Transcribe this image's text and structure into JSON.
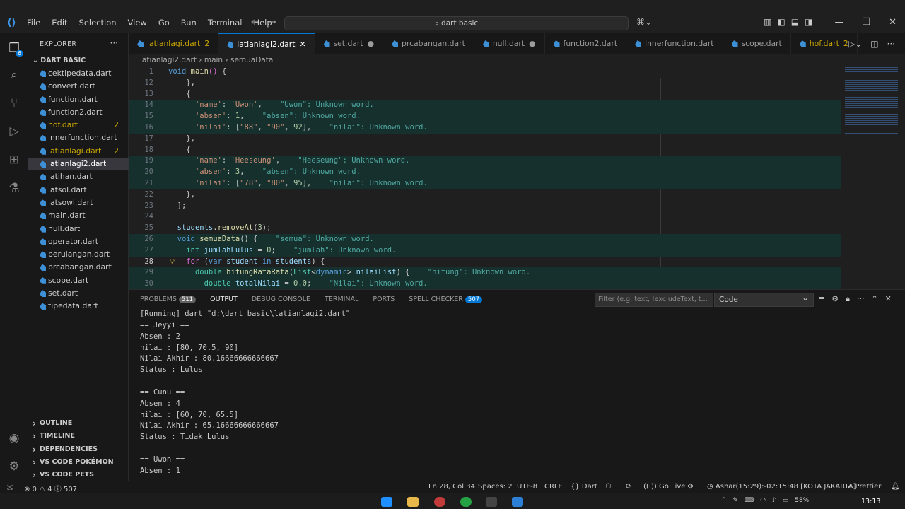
{
  "titlebar": {
    "menu": [
      "File",
      "Edit",
      "Selection",
      "View",
      "Go",
      "Run",
      "Terminal",
      "Help"
    ],
    "search": "dart basic"
  },
  "sidebar": {
    "header": "EXPLORER",
    "folder": "DART BASIC",
    "files": [
      {
        "name": "cektipedata.dart",
        "count": "",
        "state": "normal"
      },
      {
        "name": "convert.dart",
        "count": "",
        "state": "normal"
      },
      {
        "name": "function.dart",
        "count": "",
        "state": "normal"
      },
      {
        "name": "function2.dart",
        "count": "",
        "state": "normal"
      },
      {
        "name": "hof.dart",
        "count": "2",
        "state": "warn"
      },
      {
        "name": "innerfunction.dart",
        "count": "",
        "state": "normal"
      },
      {
        "name": "latianlagi.dart",
        "count": "2",
        "state": "warn"
      },
      {
        "name": "latianlagi2.dart",
        "count": "",
        "state": "selected"
      },
      {
        "name": "latihan.dart",
        "count": "",
        "state": "normal"
      },
      {
        "name": "latsol.dart",
        "count": "",
        "state": "normal"
      },
      {
        "name": "latsowl.dart",
        "count": "",
        "state": "normal"
      },
      {
        "name": "main.dart",
        "count": "",
        "state": "normal"
      },
      {
        "name": "null.dart",
        "count": "",
        "state": "normal"
      },
      {
        "name": "operator.dart",
        "count": "",
        "state": "normal"
      },
      {
        "name": "perulangan.dart",
        "count": "",
        "state": "normal"
      },
      {
        "name": "prcabangan.dart",
        "count": "",
        "state": "normal"
      },
      {
        "name": "scope.dart",
        "count": "",
        "state": "normal"
      },
      {
        "name": "set.dart",
        "count": "",
        "state": "normal"
      },
      {
        "name": "tipedata.dart",
        "count": "",
        "state": "normal"
      }
    ],
    "sections": [
      "OUTLINE",
      "TIMELINE",
      "DEPENDENCIES",
      "VS CODE POKÉMON",
      "VS CODE PETS"
    ]
  },
  "tabs": [
    {
      "name": "latianlagi.dart",
      "suffix": "2",
      "state": "warn"
    },
    {
      "name": "latianlagi2.dart",
      "suffix": "✕",
      "state": "active"
    },
    {
      "name": "set.dart",
      "suffix": "●",
      "state": "normal"
    },
    {
      "name": "prcabangan.dart",
      "suffix": "",
      "state": "normal"
    },
    {
      "name": "null.dart",
      "suffix": "●",
      "state": "normal"
    },
    {
      "name": "function2.dart",
      "suffix": "",
      "state": "normal"
    },
    {
      "name": "innerfunction.dart",
      "suffix": "",
      "state": "normal"
    },
    {
      "name": "scope.dart",
      "suffix": "",
      "state": "normal"
    },
    {
      "name": "hof.dart",
      "suffix": "2",
      "state": "warn"
    }
  ],
  "breadcrumb": [
    "latianlagi2.dart",
    "main",
    "semuaData"
  ],
  "editor": {
    "lines": [
      {
        "n": "1",
        "hl": false,
        "cur": false,
        "html": "<span class='kw'>void</span> <span class='fn'>main</span><span class='pu'>()</span> {"
      },
      {
        "n": "12",
        "hl": false,
        "cur": false,
        "html": "    },"
      },
      {
        "n": "13",
        "hl": false,
        "cur": false,
        "html": "    {"
      },
      {
        "n": "14",
        "hl": true,
        "cur": false,
        "html": "      <span class='str'>'name'</span>: <span class='str'>'Uwon'</span>,    <span class='sp'>\"Uwon\": Unknown word.</span>"
      },
      {
        "n": "15",
        "hl": true,
        "cur": false,
        "html": "      <span class='str'>'absen'</span>: <span class='num'>1</span>,    <span class='sp'>\"absen\": Unknown word.</span>"
      },
      {
        "n": "16",
        "hl": true,
        "cur": false,
        "html": "      <span class='str'>'nilai'</span>: [<span class='str'>\"88\"</span>, <span class='str'>\"90\"</span>, <span class='num'>92</span>],    <span class='sp'>\"nilai\": Unknown word.</span>"
      },
      {
        "n": "17",
        "hl": false,
        "cur": false,
        "html": "    },"
      },
      {
        "n": "18",
        "hl": false,
        "cur": false,
        "html": "    {"
      },
      {
        "n": "19",
        "hl": true,
        "cur": false,
        "html": "      <span class='str'>'name'</span>: <span class='str'>'Heeseung'</span>,    <span class='sp'>\"Heeseung\": Unknown word.</span>"
      },
      {
        "n": "20",
        "hl": true,
        "cur": false,
        "html": "      <span class='str'>'absen'</span>: <span class='num'>3</span>,    <span class='sp'>\"absen\": Unknown word.</span>"
      },
      {
        "n": "21",
        "hl": true,
        "cur": false,
        "html": "      <span class='str'>'nilai'</span>: [<span class='str'>\"78\"</span>, <span class='str'>\"80\"</span>, <span class='num'>95</span>],    <span class='sp'>\"nilai\": Unknown word.</span>"
      },
      {
        "n": "22",
        "hl": false,
        "cur": false,
        "html": "    },"
      },
      {
        "n": "23",
        "hl": false,
        "cur": false,
        "html": "  ];"
      },
      {
        "n": "24",
        "hl": false,
        "cur": false,
        "html": ""
      },
      {
        "n": "25",
        "hl": false,
        "cur": false,
        "html": "  <span class='var'>students</span>.<span class='fn'>removeAt</span>(<span class='num'>3</span>);"
      },
      {
        "n": "26",
        "hl": true,
        "cur": false,
        "html": "  <span class='kw'>void</span> <span class='fn'>semuaData</span>() {    <span class='sp'>\"semua\": Unknown word.</span>"
      },
      {
        "n": "27",
        "hl": true,
        "cur": false,
        "html": "    <span class='ty'>int</span> <span class='var'>jumlahLulus</span> = <span class='num'>0</span>;    <span class='sp'>\"jumlah\": Unknown word.</span>"
      },
      {
        "n": "28",
        "hl": false,
        "cur": true,
        "html": "    <span class='pu'>for</span> (<span class='kw'>var</span> <span class='var'>student</span> <span class='kw'>in</span> <span class='var'>students</span>) {"
      },
      {
        "n": "29",
        "hl": true,
        "cur": false,
        "html": "      <span class='ty'>double</span> <span class='fn'>hitungRataRata</span>(<span class='ty'>List</span>&lt;<span class='kw'>dynamic</span>&gt; <span class='var'>nilaiList</span>) {    <span class='sp'>\"hitung\": Unknown word.</span>"
      },
      {
        "n": "30",
        "hl": true,
        "cur": false,
        "html": "        <span class='ty'>double</span> <span class='var'>totalNilai</span> = <span class='num'>0.0</span>;    <span class='sp'>\"Nilai\": Unknown word.</span>"
      }
    ]
  },
  "panel": {
    "tabs": [
      {
        "label": "PROBLEMS",
        "badge": "511",
        "active": false
      },
      {
        "label": "OUTPUT",
        "badge": "",
        "active": true
      },
      {
        "label": "DEBUG CONSOLE",
        "badge": "",
        "active": false
      },
      {
        "label": "TERMINAL",
        "badge": "",
        "active": false
      },
      {
        "label": "PORTS",
        "badge": "",
        "active": false
      },
      {
        "label": "SPELL CHECKER",
        "badge": "507",
        "active": false
      }
    ],
    "filter_placeholder": "Filter (e.g. text, !excludeText, t...",
    "channel": "Code",
    "output": [
      "[Running] dart \"d:\\dart basic\\latianlagi2.dart\"",
      "== Jeyyi ==",
      "Absen : 2",
      "nilai : [80, 70.5, 90]",
      "Nilai Akhir : 80.16666666666667",
      "Status : Lulus",
      "",
      "== Cunu ==",
      "Absen : 4",
      "nilai : [60, 70, 65.5]",
      "Nilai Akhir : 65.16666666666667",
      "Status : Tidak Lulus",
      "",
      "== Uwon ==",
      "Absen : 1"
    ]
  },
  "status": {
    "problems": "⊗ 0 ⚠ 4 ⓘ 507",
    "position": "Ln 28, Col 34",
    "spaces": "Spaces: 2",
    "encoding": "UTF-8",
    "eol": "CRLF",
    "language": "{} Dart",
    "golive": "((·)) Go Live",
    "prayer": "Ashar(15:29):-02:15:48 [KOTA JAKARTA]",
    "prettier": "✓ Prettier"
  },
  "taskbar": {
    "battery": "58%",
    "time": "13:13"
  }
}
